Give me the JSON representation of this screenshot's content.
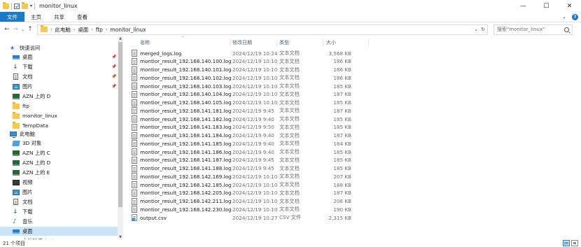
{
  "window": {
    "title": "monitor_linux",
    "controls": {
      "minimize": "—",
      "maximize": "☐",
      "close": "✕"
    }
  },
  "ribbon": {
    "tabs": [
      "文件",
      "主页",
      "共享",
      "查看"
    ]
  },
  "address": {
    "crumbs": [
      "此电脑",
      "桌面",
      "ftp",
      "monitor_linux"
    ],
    "search_placeholder": "搜索\"monitor_linux\""
  },
  "nav": {
    "quick_access": "快速访问",
    "quick_items": [
      {
        "label": "桌面",
        "icon": "desktop-icon",
        "pinned": true
      },
      {
        "label": "下载",
        "icon": "download-icon",
        "pinned": true
      },
      {
        "label": "文档",
        "icon": "document-icon",
        "pinned": true
      },
      {
        "label": "图片",
        "icon": "pictures-icon",
        "pinned": true
      },
      {
        "label": "AZN 上的 D",
        "icon": "network-drive-icon",
        "pinned": false
      },
      {
        "label": "ftp",
        "icon": "folder-icon",
        "pinned": false
      },
      {
        "label": "monitor_linux",
        "icon": "folder-icon",
        "pinned": false
      },
      {
        "label": "TempData",
        "icon": "folder-icon",
        "pinned": false
      }
    ],
    "this_pc": "此电脑",
    "pc_items": [
      {
        "label": "3D 对象",
        "icon": "3d-objects-icon"
      },
      {
        "label": "AZN 上的 C",
        "icon": "network-drive-icon"
      },
      {
        "label": "AZN 上的 D",
        "icon": "network-drive-icon"
      },
      {
        "label": "AZN 上的 E",
        "icon": "network-drive-icon"
      },
      {
        "label": "视频",
        "icon": "video-icon"
      },
      {
        "label": "图片",
        "icon": "pictures-icon"
      },
      {
        "label": "文档",
        "icon": "document-icon"
      },
      {
        "label": "下载",
        "icon": "download-icon"
      },
      {
        "label": "音乐",
        "icon": "music-icon"
      },
      {
        "label": "桌面",
        "icon": "desktop-icon",
        "selected": true
      },
      {
        "label": "本地磁盘 (C:)",
        "icon": "drive-icon"
      }
    ]
  },
  "columns": {
    "name": "名称",
    "date": "修改日期",
    "type": "类型",
    "size": "大小"
  },
  "files": [
    {
      "name": "merged_logs.log",
      "date": "2024/12/19 10:24",
      "type": "文本文档",
      "size": "3,568 KB"
    },
    {
      "name": "montior_result_192.168.140.100.log",
      "date": "2024/12/19 10:10",
      "type": "文本文档",
      "size": "186 KB"
    },
    {
      "name": "montior_result_192.168.140.101.log",
      "date": "2024/12/19 10:10",
      "type": "文本文档",
      "size": "186 KB"
    },
    {
      "name": "montior_result_192.168.140.102.log",
      "date": "2024/12/19 10:10",
      "type": "文本文档",
      "size": "186 KB"
    },
    {
      "name": "montior_result_192.168.140.103.log",
      "date": "2024/12/19 10:10",
      "type": "文本文档",
      "size": "185 KB"
    },
    {
      "name": "montior_result_192.168.140.104.log",
      "date": "2024/12/19 10:10",
      "type": "文本文档",
      "size": "187 KB"
    },
    {
      "name": "montior_result_192.168.140.105.log",
      "date": "2024/12/19 10:10",
      "type": "文本文档",
      "size": "185 KB"
    },
    {
      "name": "montior_result_192.168.141.181.log",
      "date": "2024/12/19 9:45",
      "type": "文本文档",
      "size": "187 KB"
    },
    {
      "name": "montior_result_192.168.141.182.log",
      "date": "2024/12/19 9:40",
      "type": "文本文档",
      "size": "185 KB"
    },
    {
      "name": "montior_result_192.168.141.183.log",
      "date": "2024/12/19 9:50",
      "type": "文本文档",
      "size": "185 KB"
    },
    {
      "name": "montior_result_192.168.141.184.log",
      "date": "2024/12/19 9:40",
      "type": "文本文档",
      "size": "187 KB"
    },
    {
      "name": "montior_result_192.168.141.185.log",
      "date": "2024/12/19 9:40",
      "type": "文本文档",
      "size": "184 KB"
    },
    {
      "name": "montior_result_192.168.141.186.log",
      "date": "2024/12/19 9:40",
      "type": "文本文档",
      "size": "185 KB"
    },
    {
      "name": "montior_result_192.168.141.187.log",
      "date": "2024/12/19 9:45",
      "type": "文本文档",
      "size": "185 KB"
    },
    {
      "name": "montior_result_192.168.141.188.log",
      "date": "2024/12/19 9:45",
      "type": "文本文档",
      "size": "185 KB"
    },
    {
      "name": "montior_result_192.168.142.169.log",
      "date": "2024/12/19 10:10",
      "type": "文本文档",
      "size": "207 KB"
    },
    {
      "name": "montior_result_192.168.142.185.log",
      "date": "2024/12/19 10:10",
      "type": "文本文档",
      "size": "188 KB"
    },
    {
      "name": "montior_result_192.168.142.205.log",
      "date": "2024/12/19 10:10",
      "type": "文本文档",
      "size": "187 KB"
    },
    {
      "name": "montior_result_192.168.142.211.log",
      "date": "2024/12/19 10:10",
      "type": "文本文档",
      "size": "206 KB"
    },
    {
      "name": "montior_result_192.168.142.230.log",
      "date": "2024/12/19 10:10",
      "type": "文本文档",
      "size": "190 KB"
    },
    {
      "name": "output.csv",
      "date": "2024/12/19 10:27",
      "type": "CSV 文件",
      "size": "2,315 KB",
      "icon": "csv-file-icon"
    }
  ],
  "status": {
    "item_count": "21 个项目"
  }
}
